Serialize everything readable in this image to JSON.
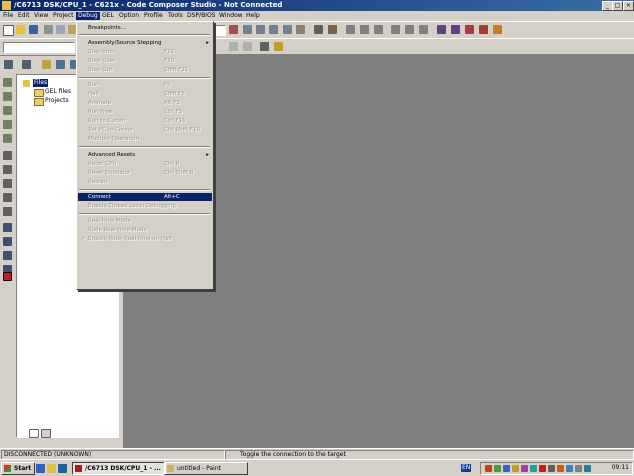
{
  "window": {
    "title": "/C6713 DSK/CPU_1 - C621x - Code Composer Studio - Not Connected"
  },
  "menubar": {
    "items": [
      "File",
      "Edit",
      "View",
      "Project",
      "Debug",
      "GEL",
      "Option",
      "Profile",
      "Tools",
      "DSP/BIOS",
      "Window",
      "Help"
    ],
    "active": "Debug"
  },
  "project": {
    "root_label": "Files",
    "children": [
      "GEL files",
      "Projects"
    ]
  },
  "debug_menu": {
    "items": [
      {
        "label": "Breakpoints...",
        "shortcut": "",
        "enabled": true
      },
      {
        "label": "Assembly/Source Stepping",
        "shortcut": "",
        "enabled": true,
        "submenu": true
      },
      {
        "label": "Step Into",
        "shortcut": "F11",
        "enabled": false
      },
      {
        "label": "Step Over",
        "shortcut": "F10",
        "enabled": false
      },
      {
        "label": "Step Out",
        "shortcut": "Shift F11",
        "enabled": false
      },
      {
        "label": "Run",
        "shortcut": "F5",
        "enabled": false
      },
      {
        "label": "Halt",
        "shortcut": "Shift F5",
        "enabled": false
      },
      {
        "label": "Animate",
        "shortcut": "Alt F5",
        "enabled": false
      },
      {
        "label": "Run Free",
        "shortcut": "Ctrl F5",
        "enabled": false
      },
      {
        "label": "Run to Cursor",
        "shortcut": "Ctrl F10",
        "enabled": false
      },
      {
        "label": "Set PC to Cursor",
        "shortcut": "Ctrl Shift F10",
        "enabled": false
      },
      {
        "label": "Multiple Operation...",
        "shortcut": "",
        "enabled": false
      },
      {
        "label": "Advanced Resets",
        "shortcut": "",
        "enabled": true,
        "submenu": true
      },
      {
        "label": "Reset CPU",
        "shortcut": "Ctrl R",
        "enabled": false
      },
      {
        "label": "Reset Emulator",
        "shortcut": "Ctrl Shift R",
        "enabled": false
      },
      {
        "label": "Restart",
        "shortcut": "",
        "enabled": false
      },
      {
        "label": "Connect",
        "shortcut": "Alt+C",
        "enabled": true,
        "highlighted": true
      },
      {
        "label": "Enable Thread Level Debugging",
        "shortcut": "",
        "enabled": false
      },
      {
        "label": "Real-time Mode",
        "shortcut": "",
        "enabled": false
      },
      {
        "label": "Rude Real-time Mode",
        "shortcut": "",
        "enabled": false
      },
      {
        "label": "Enable Rude Real-time on Halt",
        "shortcut": "",
        "enabled": false
      }
    ]
  },
  "statusbar": {
    "connection": "DISCONNECTED (UNKNOWN)",
    "message": "Toggle the connection to the target"
  },
  "taskbar": {
    "start_label": "Start",
    "tasks": [
      "/C6713 DSK/CPU_1 - ...",
      "untitled - Paint"
    ],
    "tray_lang": "EN",
    "clock": "09:11"
  },
  "colors": {
    "titlebar": "#0a246a",
    "workspace": "#808080",
    "face": "#d4d0c8",
    "highlight": "#0a246a"
  }
}
